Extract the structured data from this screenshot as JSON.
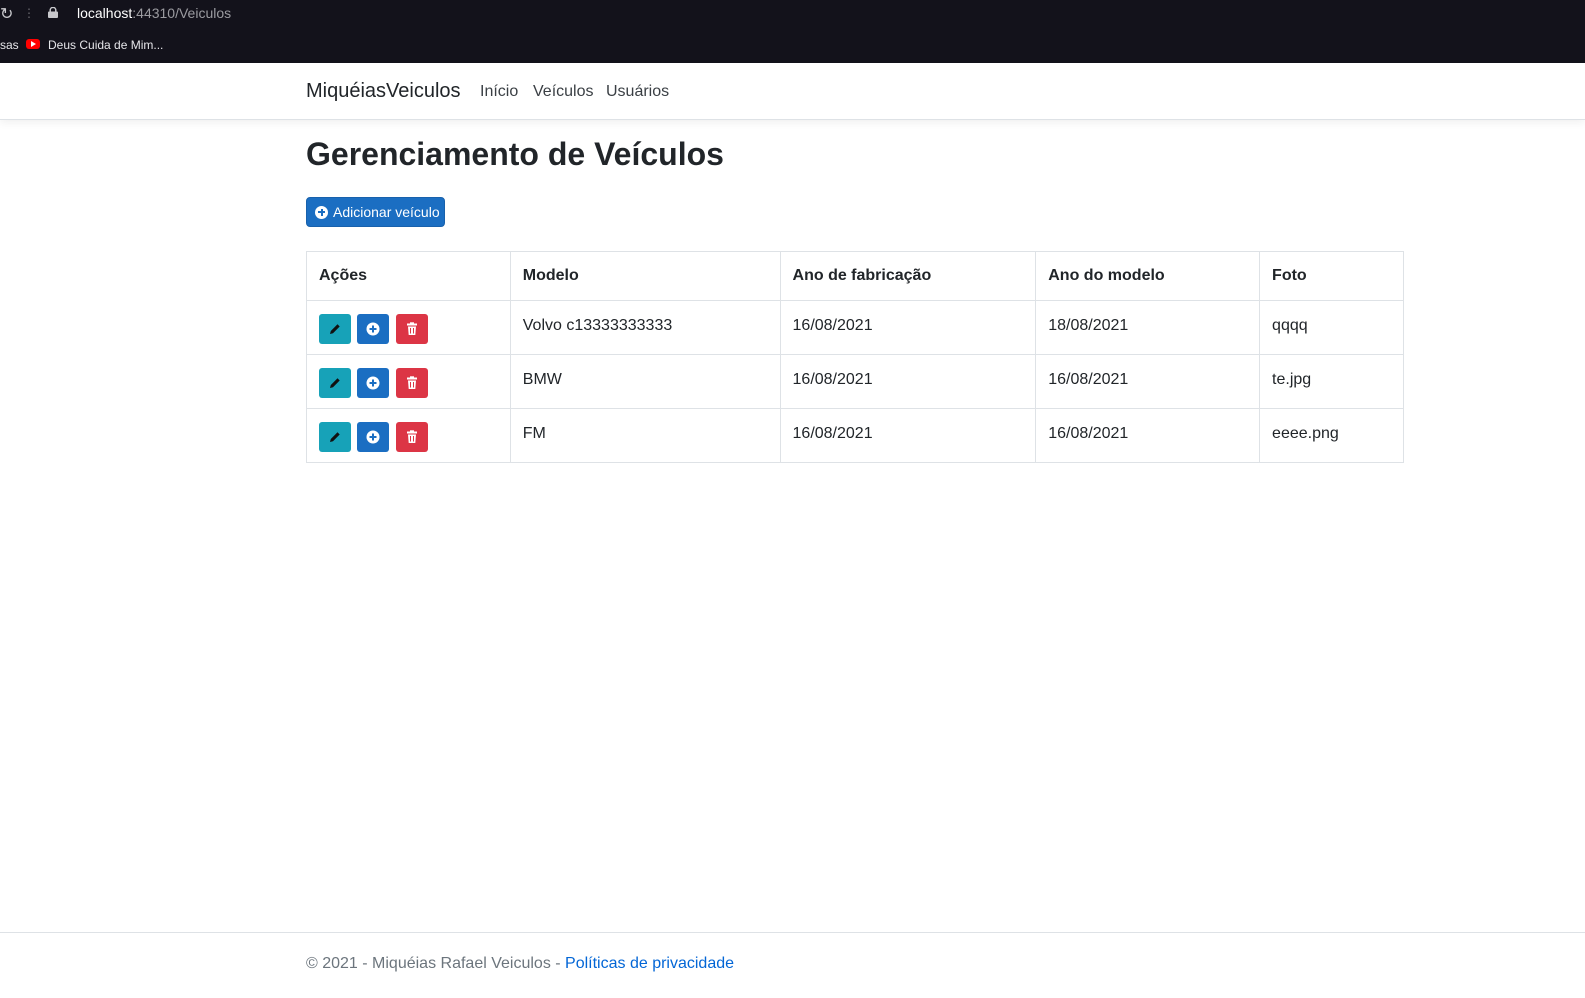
{
  "browser": {
    "url_host": "localhost",
    "url_path": ":44310/Veiculos",
    "bookmark_cut": "sas",
    "bookmark_label": "Deus Cuida de Mim..."
  },
  "navbar": {
    "brand": "MiquéiasVeiculos",
    "links": [
      "Início",
      "Veículos",
      "Usuários"
    ]
  },
  "page": {
    "title": "Gerenciamento de Veículos",
    "add_button": "Adicionar veículo"
  },
  "table": {
    "headers": [
      "Ações",
      "Modelo",
      "Ano de fabricação",
      "Ano do modelo",
      "Foto"
    ],
    "rows": [
      {
        "modelo": "Volvo c13333333333",
        "ano_fabricacao": "16/08/2021",
        "ano_modelo": "18/08/2021",
        "foto": "qqqq"
      },
      {
        "modelo": "BMW",
        "ano_fabricacao": "16/08/2021",
        "ano_modelo": "16/08/2021",
        "foto": "te.jpg"
      },
      {
        "modelo": "FM",
        "ano_fabricacao": "16/08/2021",
        "ano_modelo": "16/08/2021",
        "foto": "eeee.png"
      }
    ],
    "row_actions": {
      "edit_icon": "pencil-icon",
      "details_icon": "plus-circle-icon",
      "delete_icon": "trash-icon"
    }
  },
  "footer": {
    "text": "© 2021 - Miquéias Rafael Veiculos - ",
    "privacy_link": "Políticas de privacidade"
  },
  "colors": {
    "primary": "#1b6ec2",
    "info": "#17a2b8",
    "danger": "#dc3545",
    "chrome_bg": "#13121b"
  }
}
